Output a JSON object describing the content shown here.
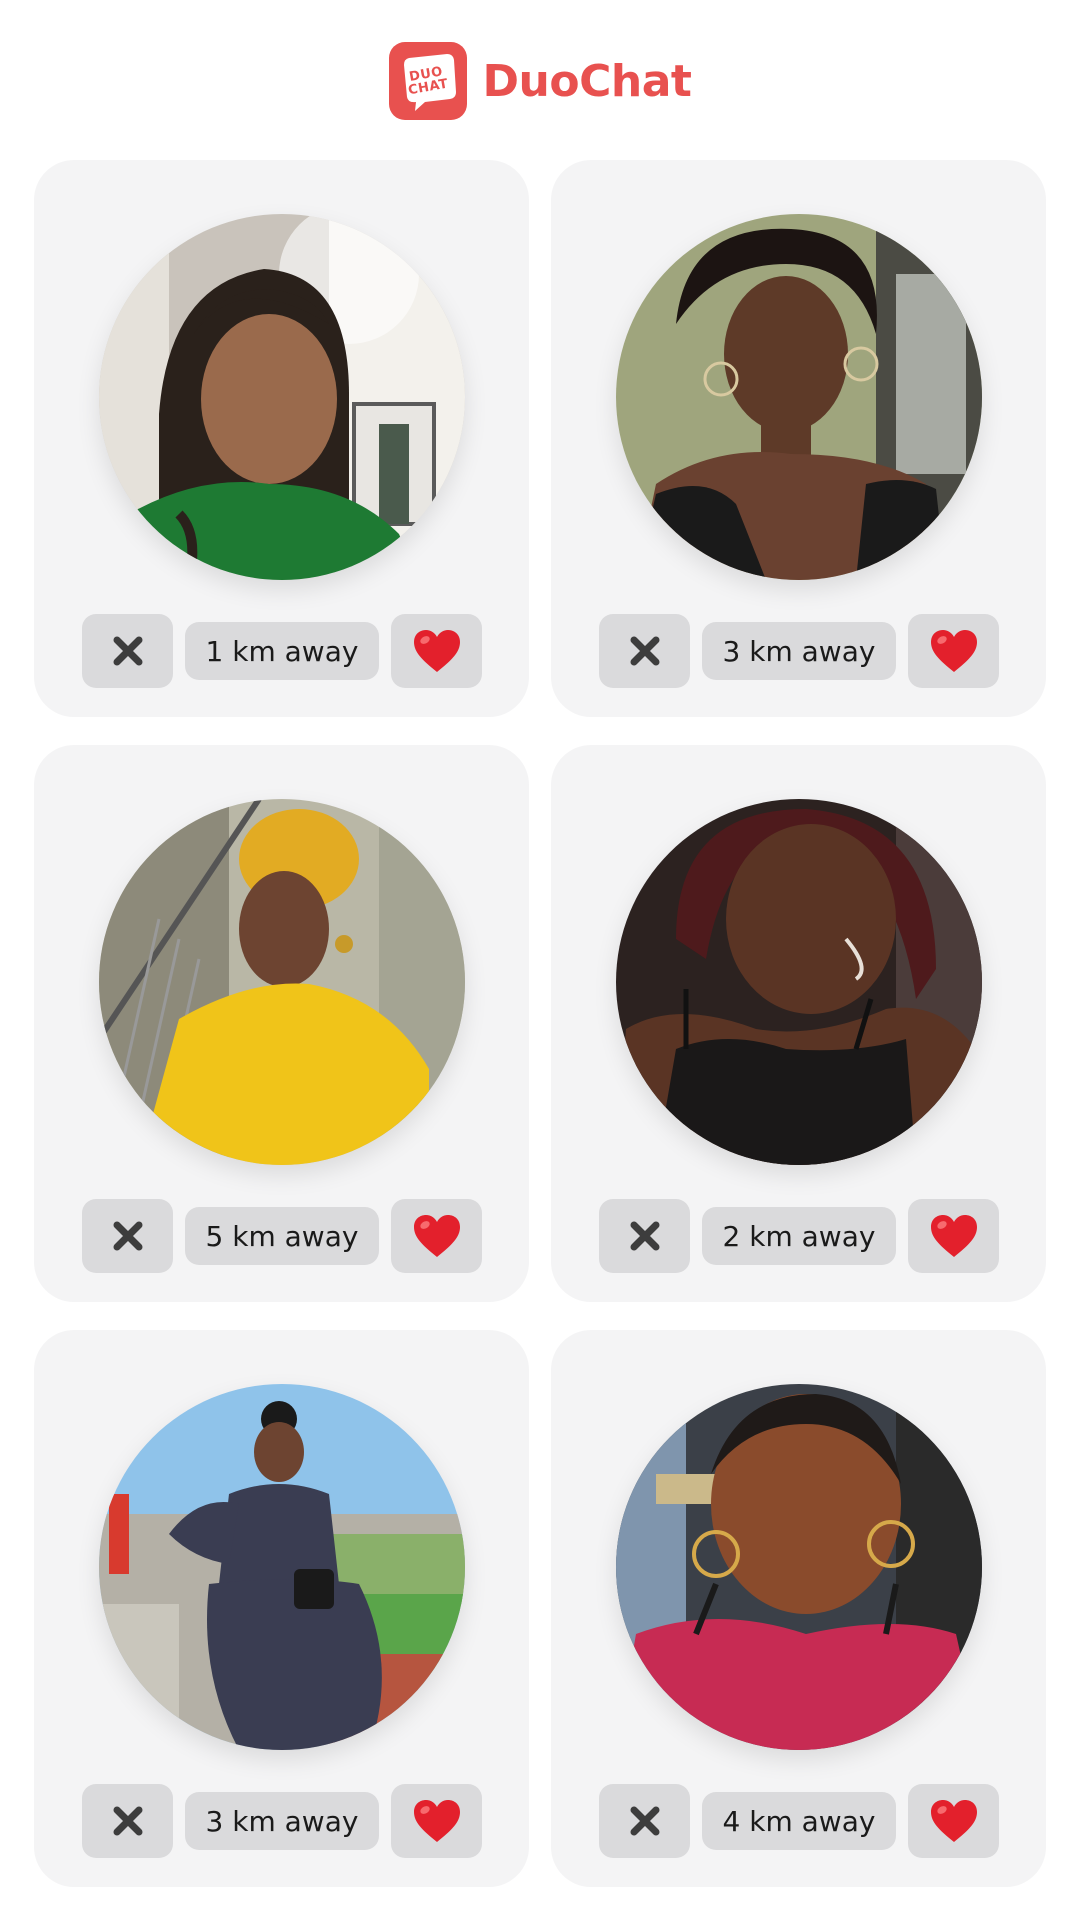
{
  "app": {
    "logo_line1": "DUO",
    "logo_line2": "CHAT",
    "name": "DuoChat",
    "brand_color": "#e8514f"
  },
  "profiles": [
    {
      "distance": "1 km away",
      "photo": "profile-photo",
      "close_icon": "close-icon",
      "like_icon": "heart-icon"
    },
    {
      "distance": "3 km away",
      "photo": "profile-photo",
      "close_icon": "close-icon",
      "like_icon": "heart-icon"
    },
    {
      "distance": "5 km away",
      "photo": "profile-photo",
      "close_icon": "close-icon",
      "like_icon": "heart-icon"
    },
    {
      "distance": "2 km away",
      "photo": "profile-photo",
      "close_icon": "close-icon",
      "like_icon": "heart-icon"
    },
    {
      "distance": "3 km away",
      "photo": "profile-photo",
      "close_icon": "close-icon",
      "like_icon": "heart-icon"
    },
    {
      "distance": "4 km away",
      "photo": "profile-photo",
      "close_icon": "close-icon",
      "like_icon": "heart-icon"
    }
  ],
  "colors": {
    "card_bg": "#f4f4f5",
    "button_bg": "#dadadc",
    "heart": "#e3202c",
    "close": "#3d3d3d"
  }
}
